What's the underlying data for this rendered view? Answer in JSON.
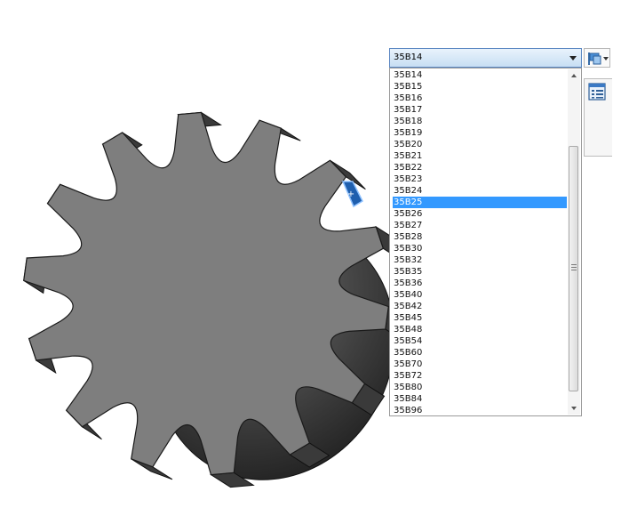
{
  "size_selector": {
    "selected_value": "35B14",
    "options": [
      "35B14",
      "35B15",
      "35B16",
      "35B17",
      "35B18",
      "35B19",
      "35B20",
      "35B21",
      "35B22",
      "35B23",
      "35B24",
      "35B25",
      "35B26",
      "35B27",
      "35B28",
      "35B30",
      "35B32",
      "35B35",
      "35B36",
      "35B40",
      "35B42",
      "35B45",
      "35B48",
      "35B54",
      "35B60",
      "35B70",
      "35B72",
      "35B80",
      "35B84",
      "35B96"
    ],
    "highlighted_option": "35B25"
  },
  "icons": {
    "dropdown_arrow": "chevron-down-icon",
    "flag_button": "flag-icon",
    "panel_button": "list-view-icon",
    "triad": "handle-icon"
  },
  "colors": {
    "selection": "#3399ff",
    "combo_border": "#5b87c2",
    "sprocket_face": "#7e7e7e",
    "sprocket_side": "#3a3a3a"
  }
}
